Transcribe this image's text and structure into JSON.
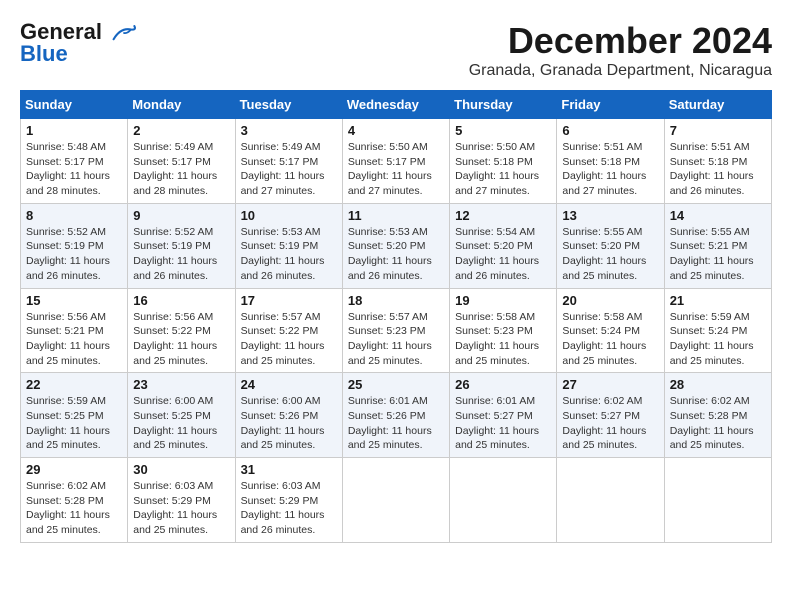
{
  "header": {
    "logo_line1": "General",
    "logo_line2": "Blue",
    "month": "December 2024",
    "location": "Granada, Granada Department, Nicaragua"
  },
  "weekdays": [
    "Sunday",
    "Monday",
    "Tuesday",
    "Wednesday",
    "Thursday",
    "Friday",
    "Saturday"
  ],
  "weeks": [
    [
      {
        "day": "1",
        "sunrise": "5:48 AM",
        "sunset": "5:17 PM",
        "daylight": "11 hours and 28 minutes."
      },
      {
        "day": "2",
        "sunrise": "5:49 AM",
        "sunset": "5:17 PM",
        "daylight": "11 hours and 28 minutes."
      },
      {
        "day": "3",
        "sunrise": "5:49 AM",
        "sunset": "5:17 PM",
        "daylight": "11 hours and 27 minutes."
      },
      {
        "day": "4",
        "sunrise": "5:50 AM",
        "sunset": "5:17 PM",
        "daylight": "11 hours and 27 minutes."
      },
      {
        "day": "5",
        "sunrise": "5:50 AM",
        "sunset": "5:18 PM",
        "daylight": "11 hours and 27 minutes."
      },
      {
        "day": "6",
        "sunrise": "5:51 AM",
        "sunset": "5:18 PM",
        "daylight": "11 hours and 27 minutes."
      },
      {
        "day": "7",
        "sunrise": "5:51 AM",
        "sunset": "5:18 PM",
        "daylight": "11 hours and 26 minutes."
      }
    ],
    [
      {
        "day": "8",
        "sunrise": "5:52 AM",
        "sunset": "5:19 PM",
        "daylight": "11 hours and 26 minutes."
      },
      {
        "day": "9",
        "sunrise": "5:52 AM",
        "sunset": "5:19 PM",
        "daylight": "11 hours and 26 minutes."
      },
      {
        "day": "10",
        "sunrise": "5:53 AM",
        "sunset": "5:19 PM",
        "daylight": "11 hours and 26 minutes."
      },
      {
        "day": "11",
        "sunrise": "5:53 AM",
        "sunset": "5:20 PM",
        "daylight": "11 hours and 26 minutes."
      },
      {
        "day": "12",
        "sunrise": "5:54 AM",
        "sunset": "5:20 PM",
        "daylight": "11 hours and 26 minutes."
      },
      {
        "day": "13",
        "sunrise": "5:55 AM",
        "sunset": "5:20 PM",
        "daylight": "11 hours and 25 minutes."
      },
      {
        "day": "14",
        "sunrise": "5:55 AM",
        "sunset": "5:21 PM",
        "daylight": "11 hours and 25 minutes."
      }
    ],
    [
      {
        "day": "15",
        "sunrise": "5:56 AM",
        "sunset": "5:21 PM",
        "daylight": "11 hours and 25 minutes."
      },
      {
        "day": "16",
        "sunrise": "5:56 AM",
        "sunset": "5:22 PM",
        "daylight": "11 hours and 25 minutes."
      },
      {
        "day": "17",
        "sunrise": "5:57 AM",
        "sunset": "5:22 PM",
        "daylight": "11 hours and 25 minutes."
      },
      {
        "day": "18",
        "sunrise": "5:57 AM",
        "sunset": "5:23 PM",
        "daylight": "11 hours and 25 minutes."
      },
      {
        "day": "19",
        "sunrise": "5:58 AM",
        "sunset": "5:23 PM",
        "daylight": "11 hours and 25 minutes."
      },
      {
        "day": "20",
        "sunrise": "5:58 AM",
        "sunset": "5:24 PM",
        "daylight": "11 hours and 25 minutes."
      },
      {
        "day": "21",
        "sunrise": "5:59 AM",
        "sunset": "5:24 PM",
        "daylight": "11 hours and 25 minutes."
      }
    ],
    [
      {
        "day": "22",
        "sunrise": "5:59 AM",
        "sunset": "5:25 PM",
        "daylight": "11 hours and 25 minutes."
      },
      {
        "day": "23",
        "sunrise": "6:00 AM",
        "sunset": "5:25 PM",
        "daylight": "11 hours and 25 minutes."
      },
      {
        "day": "24",
        "sunrise": "6:00 AM",
        "sunset": "5:26 PM",
        "daylight": "11 hours and 25 minutes."
      },
      {
        "day": "25",
        "sunrise": "6:01 AM",
        "sunset": "5:26 PM",
        "daylight": "11 hours and 25 minutes."
      },
      {
        "day": "26",
        "sunrise": "6:01 AM",
        "sunset": "5:27 PM",
        "daylight": "11 hours and 25 minutes."
      },
      {
        "day": "27",
        "sunrise": "6:02 AM",
        "sunset": "5:27 PM",
        "daylight": "11 hours and 25 minutes."
      },
      {
        "day": "28",
        "sunrise": "6:02 AM",
        "sunset": "5:28 PM",
        "daylight": "11 hours and 25 minutes."
      }
    ],
    [
      {
        "day": "29",
        "sunrise": "6:02 AM",
        "sunset": "5:28 PM",
        "daylight": "11 hours and 25 minutes."
      },
      {
        "day": "30",
        "sunrise": "6:03 AM",
        "sunset": "5:29 PM",
        "daylight": "11 hours and 25 minutes."
      },
      {
        "day": "31",
        "sunrise": "6:03 AM",
        "sunset": "5:29 PM",
        "daylight": "11 hours and 26 minutes."
      },
      null,
      null,
      null,
      null
    ]
  ]
}
